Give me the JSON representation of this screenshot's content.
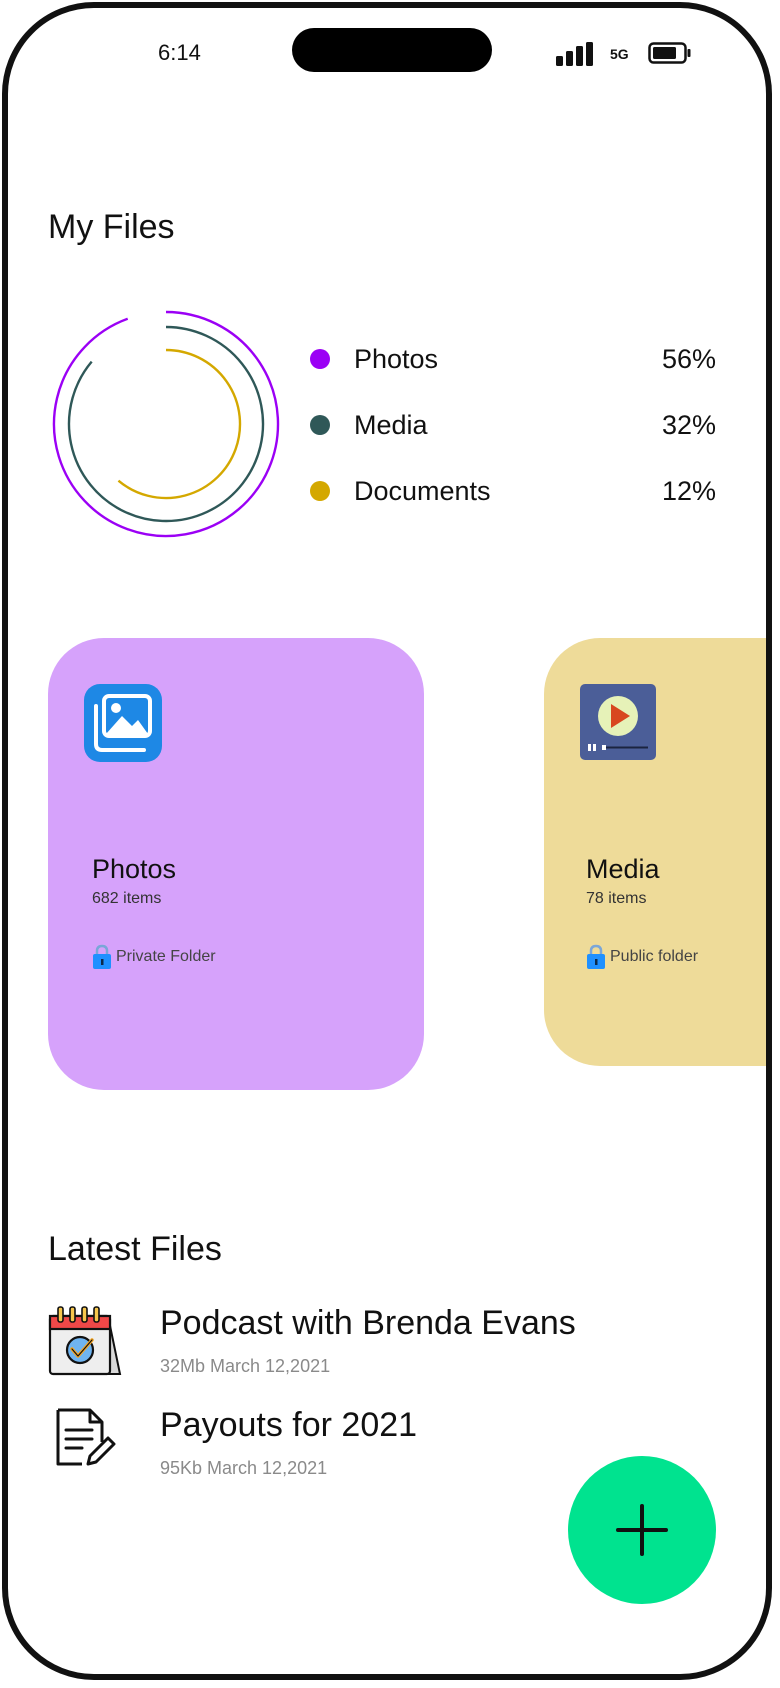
{
  "status": {
    "time": "6:14",
    "network": "5G"
  },
  "my_files": {
    "title": "My Files",
    "legend": [
      {
        "label": "Photos",
        "value": "56%",
        "color": "#9b00f5"
      },
      {
        "label": "Media",
        "value": "32%",
        "color": "#2f5858"
      },
      {
        "label": "Documents",
        "value": "12%",
        "color": "#d4a800"
      }
    ]
  },
  "chart_data": {
    "type": "pie",
    "categories": [
      "Photos",
      "Media",
      "Documents"
    ],
    "values": [
      56,
      32,
      12
    ],
    "colors": [
      "#9b00f5",
      "#2f5858",
      "#d4a800"
    ]
  },
  "folders": [
    {
      "name": "Photos",
      "count": "682 items",
      "access": "Private  Folder",
      "bg": "#d6a2fb",
      "icon": "image-gallery-icon"
    },
    {
      "name": "Media",
      "count": "78 items",
      "access": "Public folder",
      "bg": "#eedb99",
      "icon": "video-player-icon"
    }
  ],
  "latest": {
    "title": "Latest Files",
    "files": [
      {
        "name": "Podcast with Brenda Evans",
        "meta": "32Mb March 12,2021",
        "icon": "calendar-check-icon"
      },
      {
        "name": "Payouts for 2021",
        "meta": "95Kb  March  12,2021",
        "icon": "document-edit-icon"
      }
    ]
  },
  "fab": {
    "icon": "plus-icon",
    "color": "#00e38f"
  }
}
